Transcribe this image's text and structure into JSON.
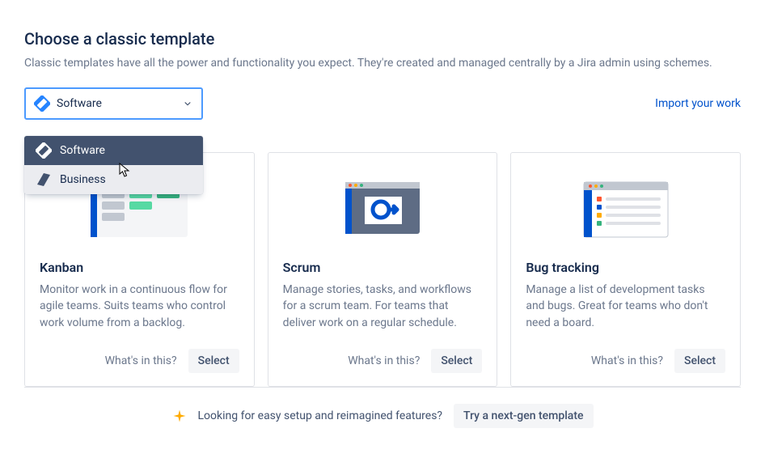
{
  "header": {
    "title": "Choose a classic template",
    "description": "Classic templates have all the power and functionality you expect. They're created and managed centrally by a Jira admin using schemes."
  },
  "selector": {
    "selected_label": "Software",
    "options": [
      {
        "label": "Software",
        "state": "selected"
      },
      {
        "label": "Business",
        "state": "hover"
      }
    ]
  },
  "import_link": "Import your work",
  "cards": [
    {
      "title": "Kanban",
      "description": "Monitor work in a continuous flow for agile teams. Suits teams who control work volume from a backlog.",
      "whats": "What's in this?",
      "select": "Select"
    },
    {
      "title": "Scrum",
      "description": "Manage stories, tasks, and workflows for a scrum team. For teams that deliver work on a regular schedule.",
      "whats": "What's in this?",
      "select": "Select"
    },
    {
      "title": "Bug tracking",
      "description": "Manage a list of development tasks and bugs. Great for teams who don't need a board.",
      "whats": "What's in this?",
      "select": "Select"
    }
  ],
  "footer": {
    "prompt": "Looking for easy setup and reimagined features?",
    "cta": "Try a next-gen template"
  },
  "colors": {
    "primary": "#0052CC",
    "focus": "#4C9AFF",
    "text": "#172B4D",
    "muted": "#6B778C"
  }
}
